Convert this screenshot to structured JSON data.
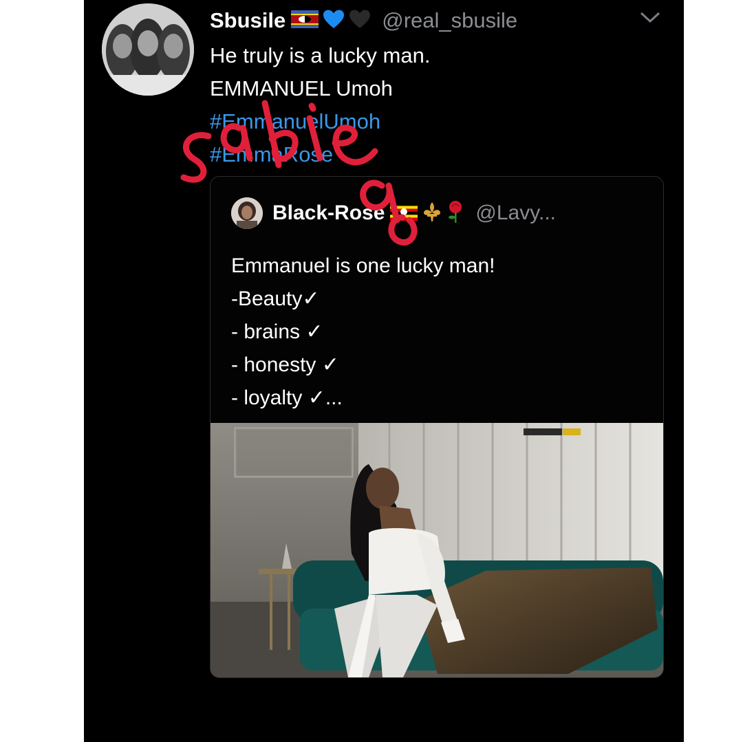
{
  "colors": {
    "background": "#000000",
    "text": "#ffffff",
    "muted": "#8b8d93",
    "link": "#3a98e8",
    "watermark": "#e0203a"
  },
  "tweet": {
    "display_name": "Sbusile",
    "badges": [
      "eswatini-flag-icon",
      "blue-heart-icon",
      "black-heart-icon"
    ],
    "handle": "@real_sbusile",
    "menu_icon": "chevron-down-icon",
    "lines": {
      "l1": "He truly is a lucky man.",
      "l2": "EMMANUEL Umoh",
      "l3": "#EmmanuelUmoh",
      "l4": "#EmmaRose"
    }
  },
  "watermark": "Sabie",
  "quote": {
    "display_name": "Black-Rose",
    "badges": [
      "uganda-flag-icon",
      "fleur-de-lis-icon",
      "rose-icon"
    ],
    "handle": "@Lavy...",
    "lines": {
      "l1": "Emmanuel is one lucky man!",
      "l2": "-Beauty✓",
      "l3": "- brains ✓",
      "l4": "- honesty ✓",
      "l5": "- loyalty ✓..."
    },
    "photo": "photo-woman-on-teal-sofa"
  }
}
